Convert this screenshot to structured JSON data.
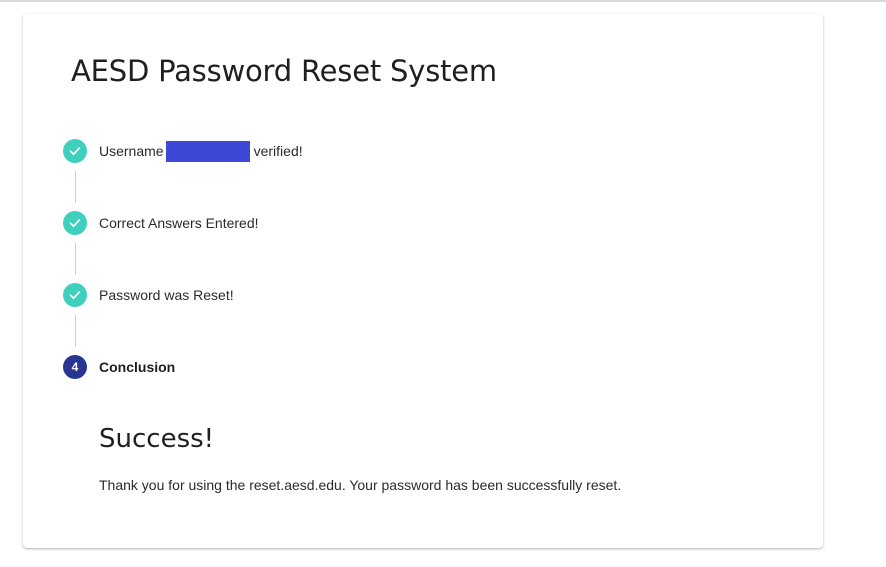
{
  "page": {
    "title": "AESD Password Reset System"
  },
  "steps": [
    {
      "status": "completed",
      "icon": "check-icon",
      "label_prefix": "Username",
      "label_suffix": "verified!"
    },
    {
      "status": "completed",
      "icon": "check-icon",
      "label": "Correct Answers Entered!"
    },
    {
      "status": "completed",
      "icon": "check-icon",
      "label": "Password was Reset!"
    },
    {
      "status": "active",
      "number": "4",
      "label": "Conclusion"
    }
  ],
  "result": {
    "heading": "Success!",
    "message": "Thank you for using the reset.aesd.edu. Your password has been successfully reset."
  },
  "colors": {
    "completed": "#3ecfbd",
    "active": "#283593",
    "redaction": "#3f48d6"
  }
}
